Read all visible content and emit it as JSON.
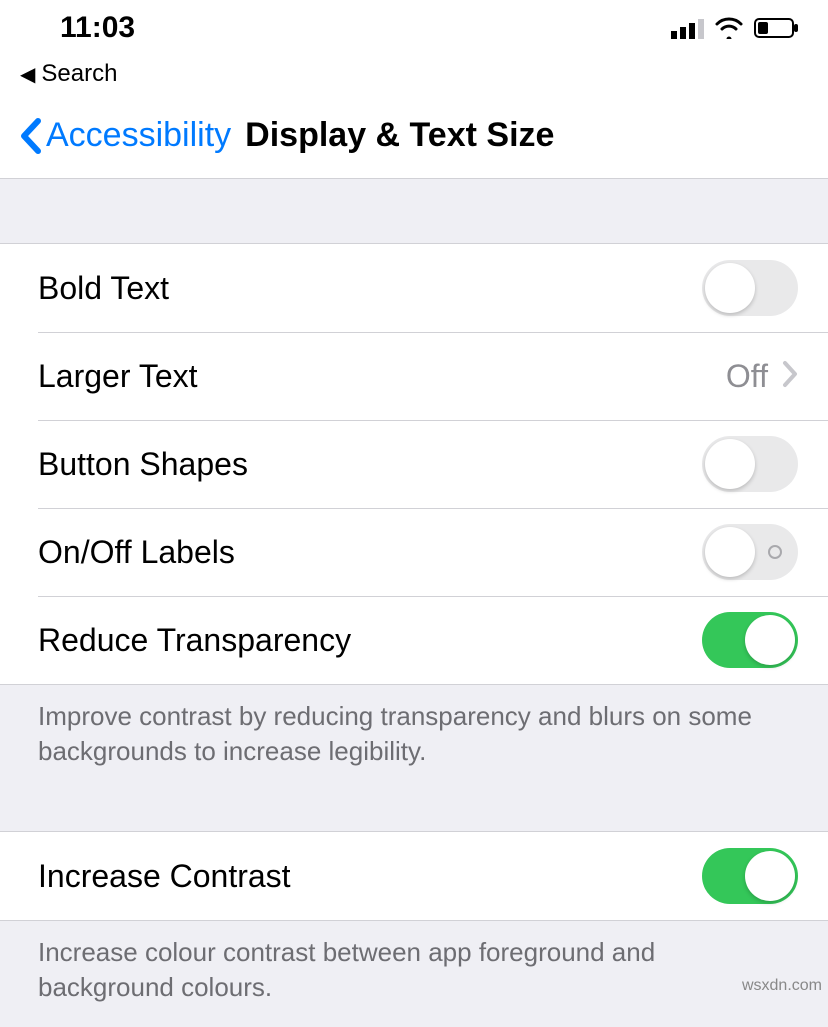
{
  "status": {
    "time": "11:03",
    "breadcrumb": "Search"
  },
  "nav": {
    "back_label": "Accessibility",
    "title": "Display & Text Size"
  },
  "group1": {
    "rows": [
      {
        "label": "Bold Text",
        "type": "switch",
        "on": false
      },
      {
        "label": "Larger Text",
        "type": "disclosure",
        "value": "Off"
      },
      {
        "label": "Button Shapes",
        "type": "switch",
        "on": false
      },
      {
        "label": "On/Off Labels",
        "type": "switch",
        "on": false,
        "show_indicator": true
      },
      {
        "label": "Reduce Transparency",
        "type": "switch",
        "on": true
      }
    ],
    "footer": "Improve contrast by reducing transparency and blurs on some backgrounds to increase legibility."
  },
  "group2": {
    "rows": [
      {
        "label": "Increase Contrast",
        "type": "switch",
        "on": true
      }
    ],
    "footer": "Increase colour contrast between app foreground and background colours."
  },
  "watermark": "wsxdn.com"
}
